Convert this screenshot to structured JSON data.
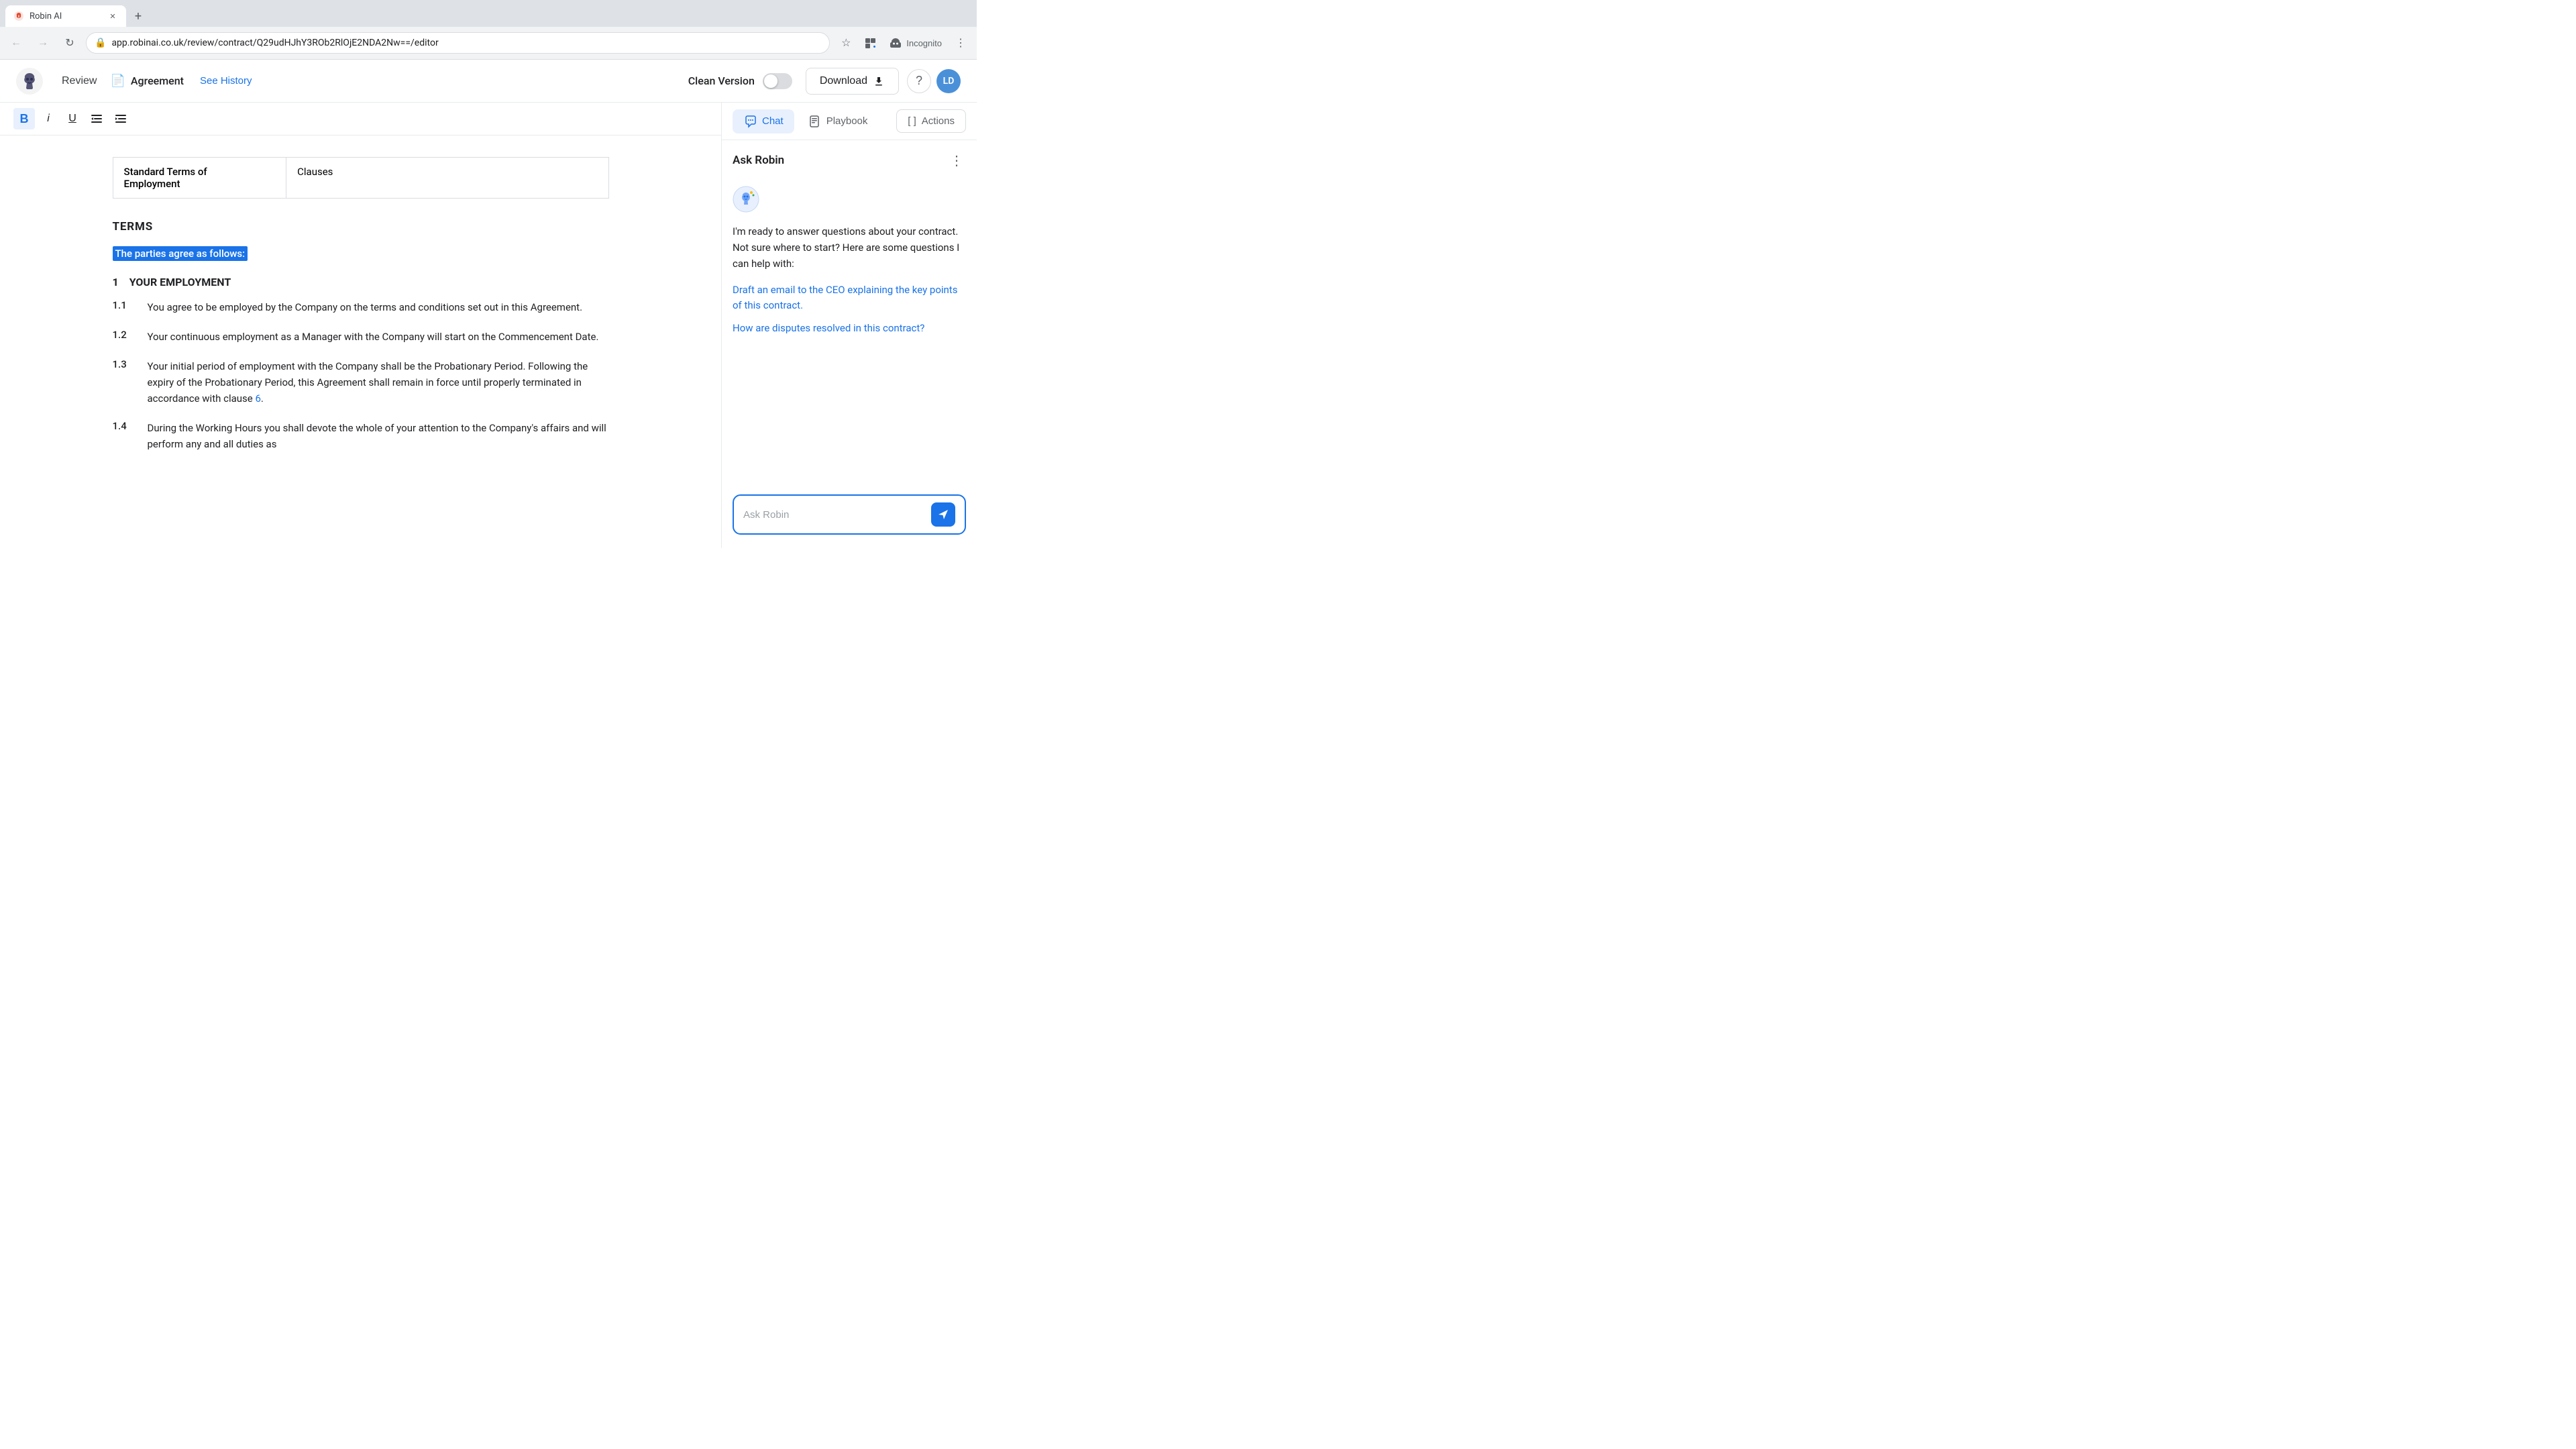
{
  "browser": {
    "tab_title": "Robin AI",
    "tab_icon": "🐦",
    "url": "app.robinai.co.uk/review/contract/Q29udHJhY3ROb2RlOjE2NDA2Nw==/editor",
    "incognito_label": "Incognito"
  },
  "header": {
    "review_label": "Review",
    "doc_title": "Agreement",
    "see_history_label": "See History",
    "clean_version_label": "Clean Version",
    "download_label": "Download",
    "avatar_initials": "LD"
  },
  "toolbar": {
    "bold_label": "B",
    "italic_label": "i",
    "underline_label": "U",
    "indent_decrease_label": "⇤",
    "indent_increase_label": "⇥"
  },
  "document": {
    "table_rows": [
      {
        "col1": "Standard Terms of Employment",
        "col2": "Clauses"
      }
    ],
    "terms_heading": "TERMS",
    "highlighted_text": "The parties agree as follows:",
    "section1_num": "1",
    "section1_title": "YOUR EMPLOYMENT",
    "clauses": [
      {
        "num": "1.1",
        "text": "You agree to be employed by the Company on the terms and conditions set out in this Agreement."
      },
      {
        "num": "1.2",
        "text": "Your continuous employment as a Manager with the Company will start on the Commencement Date."
      },
      {
        "num": "1.3",
        "text": "Your initial period of employment with the Company shall be the Probationary Period. Following the expiry of the Probationary Period, this Agreement shall remain in force until properly terminated in accordance with clause 6."
      },
      {
        "num": "1.4",
        "text": "During the Working Hours you shall devote the whole of your attention to the Company's affairs and will perform any and all duties as"
      }
    ],
    "clause_link": "6"
  },
  "right_panel": {
    "tabs": [
      {
        "id": "chat",
        "label": "Chat",
        "active": true
      },
      {
        "id": "playbook",
        "label": "Playbook",
        "active": false
      }
    ],
    "actions_label": "[ ] Actions",
    "ask_robin_title": "Ask Robin",
    "robin_message_1": "I'm ready to answer questions about your contract.",
    "robin_message_2": "Not sure where to start? Here are some questions I can help with:",
    "suggestion_1": "Draft an email to the CEO explaining the key points of this contract.",
    "suggestion_2": "How are disputes resolved in this contract?",
    "chat_input_placeholder": "Ask Robin"
  }
}
